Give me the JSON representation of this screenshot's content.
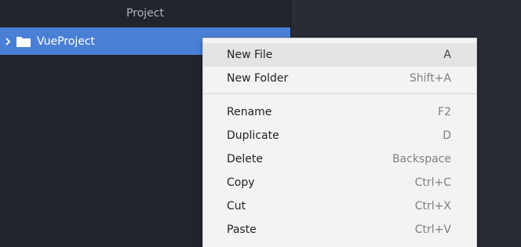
{
  "sidebar": {
    "header": "Project",
    "tree": [
      {
        "label": "VueProject",
        "icon": "folder-icon",
        "expanded": false,
        "selected": true
      }
    ]
  },
  "context_menu": {
    "groups": [
      [
        {
          "label": "New File",
          "shortcut": "A"
        },
        {
          "label": "New Folder",
          "shortcut": "Shift+A"
        }
      ],
      [
        {
          "label": "Rename",
          "shortcut": "F2"
        },
        {
          "label": "Duplicate",
          "shortcut": "D"
        },
        {
          "label": "Delete",
          "shortcut": "Backspace"
        },
        {
          "label": "Copy",
          "shortcut": "Ctrl+C"
        },
        {
          "label": "Cut",
          "shortcut": "Ctrl+X"
        },
        {
          "label": "Paste",
          "shortcut": "Ctrl+V"
        }
      ]
    ]
  },
  "colors": {
    "sidebar_bg": "#21252b",
    "selection": "#4a7fd6",
    "menu_bg": "#f3f3f3",
    "menu_hover": "#e4e4e4"
  }
}
